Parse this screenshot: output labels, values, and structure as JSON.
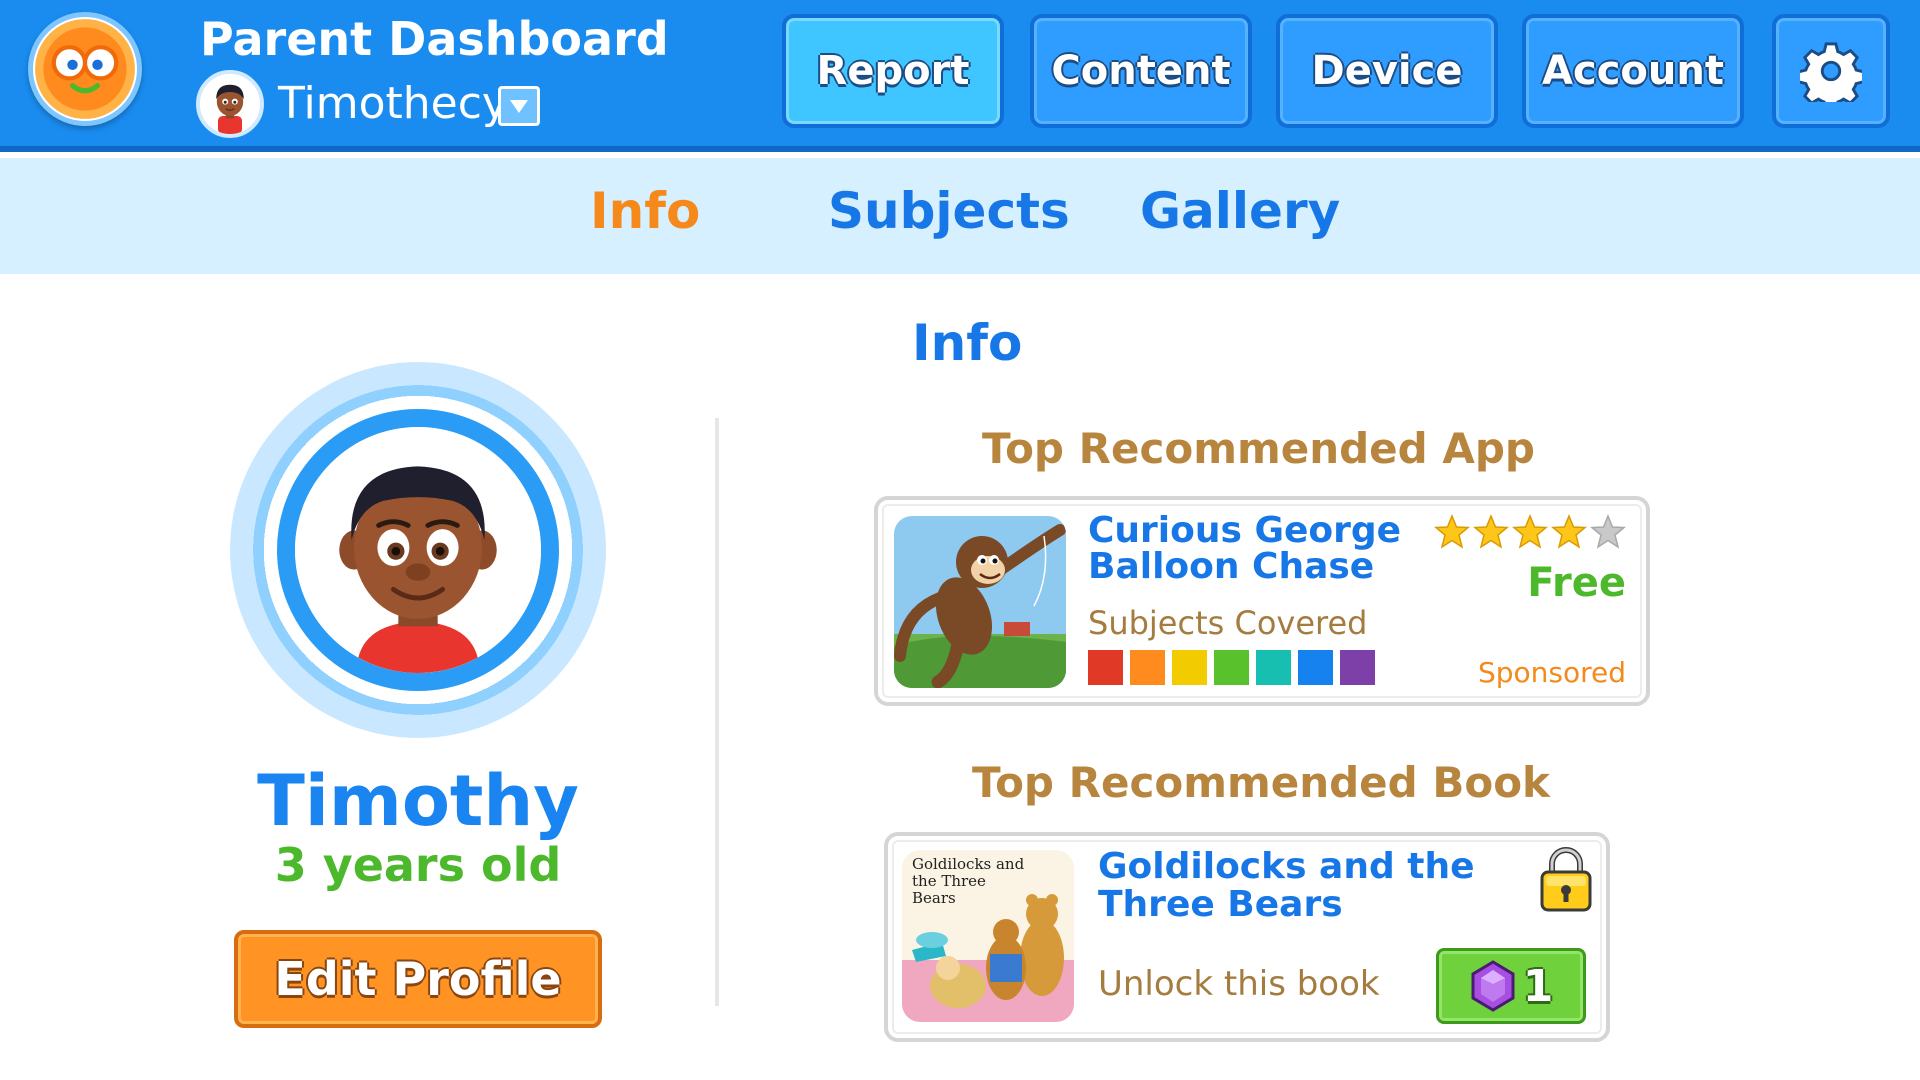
{
  "header": {
    "title": "Parent Dashboard",
    "child_name": "Timothecy",
    "nav": {
      "report": "Report",
      "content": "Content",
      "device": "Device",
      "account": "Account"
    },
    "active_nav": "Report",
    "settings_icon": "gear-icon",
    "dropdown_icon": "chevron-down-icon"
  },
  "subtabs": {
    "info": "Info",
    "subjects": "Subjects",
    "gallery": "Gallery",
    "active": "Info"
  },
  "profile": {
    "name": "Timothy",
    "age": "3 years old",
    "edit_label": "Edit Profile"
  },
  "main": {
    "title": "Info",
    "app_heading": "Top Recommended App",
    "book_heading": "Top Recommended Book"
  },
  "app": {
    "title_line1": "Curious George",
    "title_line2": "Balloon Chase",
    "rating": 4,
    "rating_max": 5,
    "price": "Free",
    "subjects_label": "Subjects Covered",
    "subject_colors": [
      "#e03a26",
      "#ff8a1e",
      "#f2cc00",
      "#59c12c",
      "#16bfb0",
      "#1682f0",
      "#7d3fa8"
    ],
    "sponsored": "Sponsored"
  },
  "book": {
    "title_line1": "Goldilocks and the",
    "title_line2": "Three Bears",
    "cover_text": "Goldilocks and the Three Bears",
    "locked": true,
    "unlock_label": "Unlock this book",
    "unlock_cost": "1"
  },
  "colors": {
    "header_blue": "#1a8cf0",
    "subtab_bg": "#d6f0ff",
    "active_tab": "#f5891c",
    "link_blue": "#1877e6",
    "heading_brown": "#b7853e",
    "green": "#4cb82b",
    "edit_orange": "#ff9424"
  }
}
